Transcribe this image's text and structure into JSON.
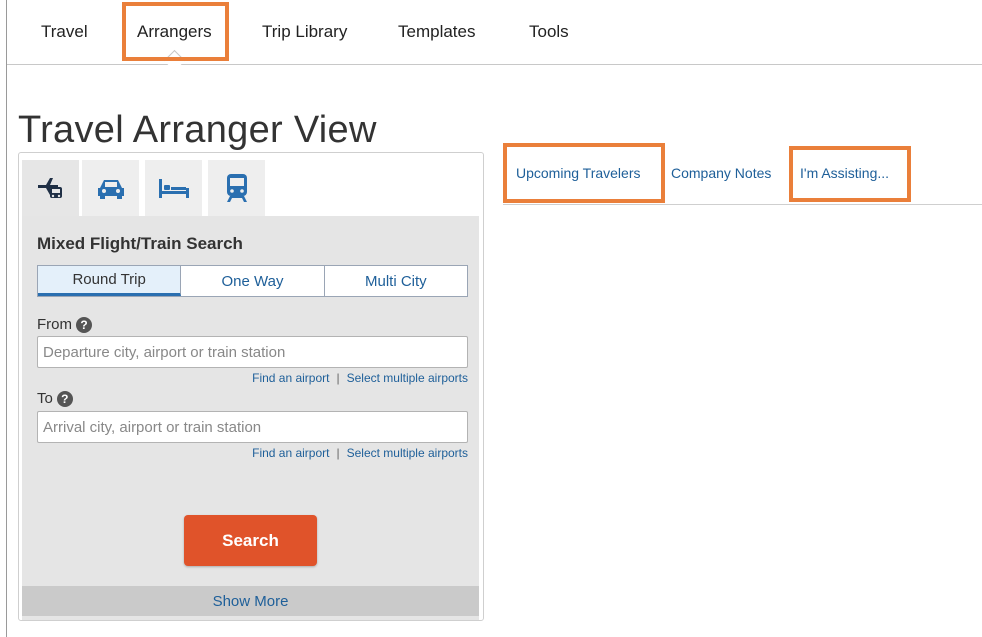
{
  "nav": {
    "tabs": [
      {
        "label": "Travel"
      },
      {
        "label": "Arrangers"
      },
      {
        "label": "Trip Library"
      },
      {
        "label": "Templates"
      },
      {
        "label": "Tools"
      }
    ],
    "active": "Arrangers"
  },
  "page": {
    "title": "Travel Arranger View"
  },
  "search": {
    "mode_icons": [
      "flight-train-icon",
      "car-icon",
      "hotel-bed-icon",
      "train-icon"
    ],
    "title": "Mixed Flight/Train Search",
    "trip_types": [
      {
        "label": "Round Trip",
        "selected": true
      },
      {
        "label": "One Way",
        "selected": false
      },
      {
        "label": "Multi City",
        "selected": false
      }
    ],
    "from": {
      "label": "From",
      "placeholder": "Departure city, airport or train station",
      "value": "",
      "find_link": "Find an airport",
      "multi_link": "Select multiple airports"
    },
    "to": {
      "label": "To",
      "placeholder": "Arrival city, airport or train station",
      "value": "",
      "find_link": "Find an airport",
      "multi_link": "Select multiple airports"
    },
    "separator": "|",
    "submit_label": "Search",
    "show_more_label": "Show More"
  },
  "right_tabs": [
    {
      "label": "Upcoming Travelers"
    },
    {
      "label": "Company Notes"
    },
    {
      "label": "I'm Assisting..."
    }
  ],
  "colors": {
    "highlight": "#ea7f3a",
    "search_button": "#e0532a",
    "link": "#1e5f99",
    "panel_body": "#e5e5e5"
  }
}
